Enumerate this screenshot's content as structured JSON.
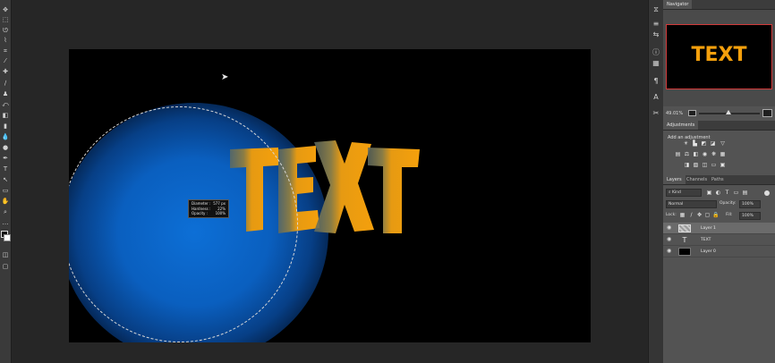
{
  "tools": [
    "move",
    "marquee",
    "lasso",
    "quick-select",
    "crop",
    "eyedropper",
    "spot-heal",
    "brush",
    "stamp",
    "history-brush",
    "eraser",
    "gradient",
    "blur",
    "dodge",
    "pen",
    "type",
    "path-select",
    "shape",
    "hand",
    "zoom",
    "more",
    "fg-bg-colors",
    "quick-mask",
    "screen-mode"
  ],
  "canvas": {
    "text": "TEXT",
    "text_colors": {
      "faded": "#6f6a48",
      "solid": "#f5a00c"
    },
    "glow_color": "#0d6fd6"
  },
  "brush_hud": {
    "rows": [
      {
        "label": "Diameter :",
        "value": "577 px"
      },
      {
        "label": "Hardness :",
        "value": "22%"
      },
      {
        "label": "Opacity :",
        "value": "100%"
      }
    ]
  },
  "navigator": {
    "tab": "Navigator",
    "preview_text": "TEXT",
    "zoom": "49.01%"
  },
  "adjustments": {
    "tab": "Adjustments",
    "hint": "Add an adjustment"
  },
  "layers_panel": {
    "tabs": [
      "Layers",
      "Channels",
      "Paths"
    ],
    "filter": "Kind",
    "blend_mode": "Normal",
    "opacity_label": "Opacity:",
    "opacity": "100%",
    "lock_label": "Lock:",
    "fill_label": "Fill:",
    "fill": "100%",
    "layers": [
      {
        "name": "Layer 1",
        "kind": "pixel",
        "selected": true
      },
      {
        "name": "TEXT",
        "kind": "type",
        "selected": false
      },
      {
        "name": "Layer 0",
        "kind": "pixel-black",
        "selected": false
      }
    ]
  }
}
